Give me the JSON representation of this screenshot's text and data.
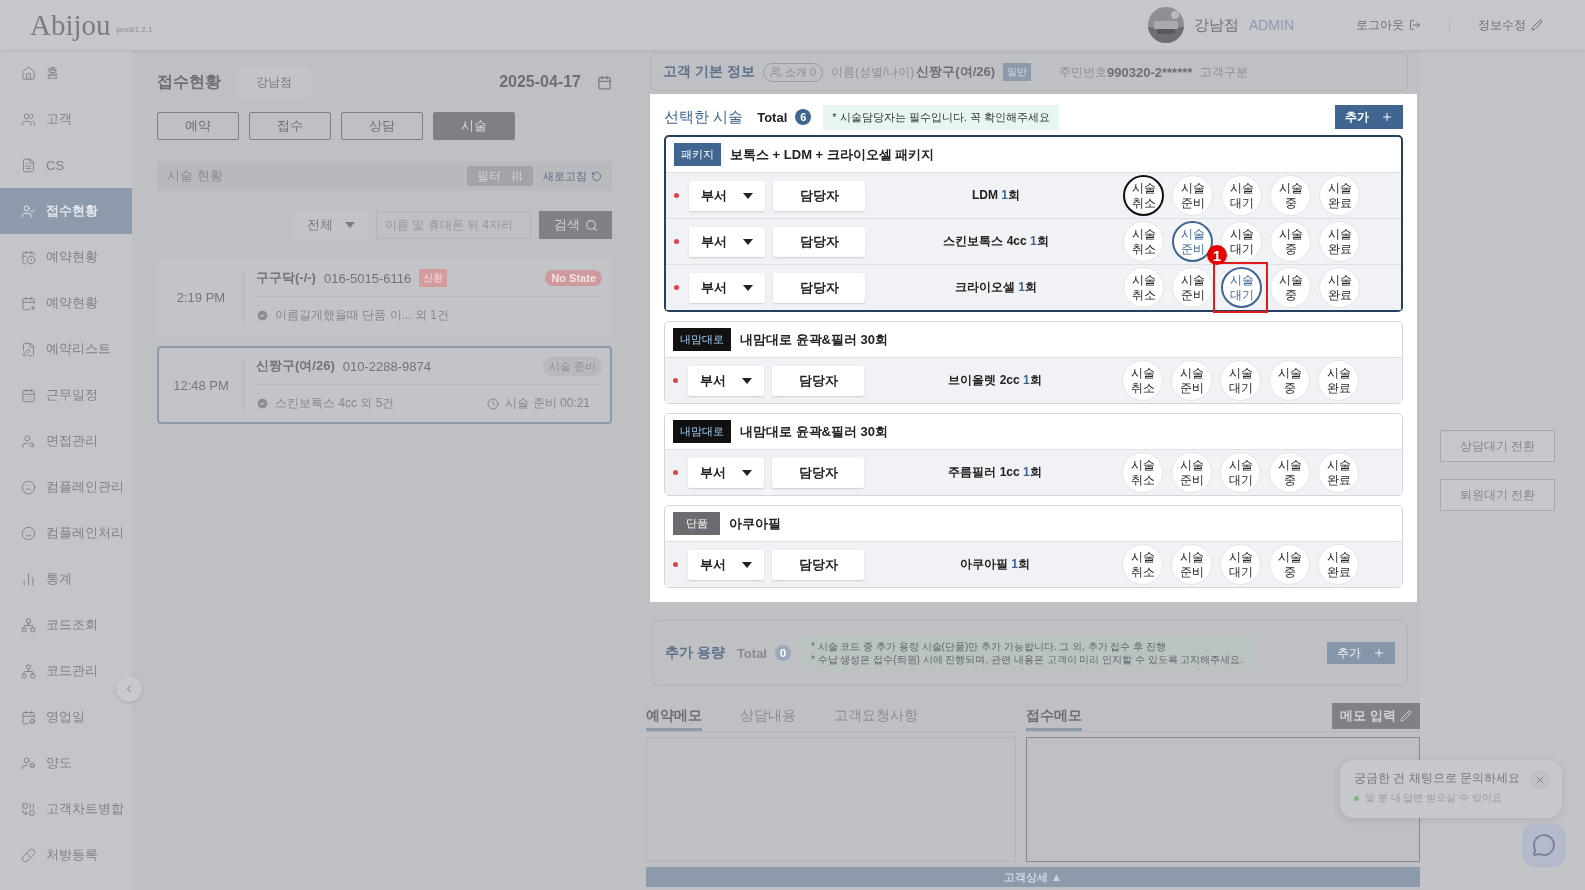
{
  "header": {
    "logo": "Abijou",
    "version": "prod/1.2.1",
    "branch": "강남점",
    "role": "ADMIN",
    "logout": "로그아웃",
    "edit_info": "정보수정"
  },
  "sidebar": {
    "items": [
      {
        "label": "홈",
        "selected": false
      },
      {
        "label": "고객",
        "selected": false
      },
      {
        "label": "CS",
        "selected": false
      },
      {
        "label": "접수현황",
        "selected": true
      },
      {
        "label": "예약현황",
        "selected": false
      },
      {
        "label": "예약현황",
        "selected": false
      },
      {
        "label": "예약리스트",
        "selected": false
      },
      {
        "label": "근무일정",
        "selected": false
      },
      {
        "label": "면접관리",
        "selected": false
      },
      {
        "label": "컴플레인관리",
        "selected": false
      },
      {
        "label": "컴플레인처리",
        "selected": false
      },
      {
        "label": "통계",
        "selected": false
      },
      {
        "label": "코드조회",
        "selected": false
      },
      {
        "label": "코드관리",
        "selected": false
      },
      {
        "label": "영업일",
        "selected": false
      },
      {
        "label": "양도",
        "selected": false
      },
      {
        "label": "고객차트병합",
        "selected": false
      },
      {
        "label": "처방등록",
        "selected": false
      }
    ]
  },
  "reception": {
    "title": "접수현황",
    "branch": "강남점",
    "date": "2025-04-17",
    "tabs": [
      {
        "label": "예약",
        "selected": false
      },
      {
        "label": "접수",
        "selected": false
      },
      {
        "label": "상담",
        "selected": false
      },
      {
        "label": "시술",
        "selected": true
      }
    ],
    "section": {
      "title": "시술 현황",
      "filter": "필터",
      "refresh": "새로고침"
    },
    "filter_select": "전체",
    "search": {
      "placeholder": "이름 및 휴대폰 뒤 4자리",
      "button": "검색"
    },
    "cards": [
      {
        "time": "2:19 PM",
        "name": "구구닥(-/-)",
        "phone": "016-5015-6116",
        "tag": "신환",
        "status": {
          "text": "No State",
          "kind": "alert"
        },
        "detail": "이름길게했을때 단품 이... 외 1건",
        "selected": false
      },
      {
        "time": "12:48 PM",
        "name": "신짱구(여/26)",
        "phone": "010-2288-9874",
        "status": {
          "text": "시술 준비",
          "kind": "normal"
        },
        "detail": "스킨보톡스 4cc 외 5건",
        "timer": "시술 준비 00:21",
        "selected": true
      }
    ]
  },
  "customer": {
    "title": "고객 기본 정보",
    "referral": "소개 0",
    "name_label": "이름(성별/나이)",
    "name": "신짱구(여/26)",
    "grade": "일반",
    "id_label": "주민번호",
    "id_number": "990320-2******",
    "type_label": "고객구분"
  },
  "selected_procedures": {
    "title": "선택한 시술",
    "total_label": "Total",
    "total": "6",
    "notice": "* 시술담당자는 필수입니다. 꼭 확인해주세요",
    "add": "추가",
    "groups": [
      {
        "kind": "package",
        "tag": "패키지",
        "name": "보톡스 + LDM + 크라이오셀 패키지",
        "selected": true,
        "rows": [
          {
            "dept": "부서",
            "staff": "담당자",
            "name": "LDM",
            "count": "1",
            "unit": "회",
            "statuses": [
              {
                "label": "시술 취소",
                "selected": true
              },
              {
                "label": "시술 준비",
                "selected": false
              },
              {
                "label": "시술 대기",
                "selected": false
              },
              {
                "label": "시술 중",
                "selected": false
              },
              {
                "label": "시술 완료",
                "selected": false
              }
            ]
          },
          {
            "dept": "부서",
            "staff": "담당자",
            "name": "스킨보톡스 4cc",
            "count": "1",
            "unit": "회",
            "statuses": [
              {
                "label": "시술 취소",
                "selected": false
              },
              {
                "label": "시술 준비",
                "selected": true
              },
              {
                "label": "시술 대기",
                "selected": false
              },
              {
                "label": "시술 중",
                "selected": false
              },
              {
                "label": "시술 완료",
                "selected": false
              }
            ]
          },
          {
            "dept": "부서",
            "staff": "담당자",
            "name": "크라이오셀",
            "count": "1",
            "unit": "회",
            "statuses": [
              {
                "label": "시술 취소",
                "selected": false
              },
              {
                "label": "시술 준비",
                "selected": false
              },
              {
                "label": "시술 대기",
                "selected": true,
                "callout": "1"
              },
              {
                "label": "시술 중",
                "selected": false
              },
              {
                "label": "시술 완료",
                "selected": false
              }
            ]
          }
        ]
      },
      {
        "kind": "custom",
        "tag": "내맘대로",
        "name": "내맘대로 윤곽&필러 30회",
        "selected": false,
        "rows": [
          {
            "dept": "부서",
            "staff": "담당자",
            "name": "브이올렛 2cc",
            "count": "1",
            "unit": "회",
            "statuses": [
              {
                "label": "시술 취소",
                "selected": false
              },
              {
                "label": "시술 준비",
                "selected": false
              },
              {
                "label": "시술 대기",
                "selected": false
              },
              {
                "label": "시술 중",
                "selected": false
              },
              {
                "label": "시술 완료",
                "selected": false
              }
            ]
          }
        ]
      },
      {
        "kind": "custom",
        "tag": "내맘대로",
        "name": "내맘대로 윤곽&필러 30회",
        "selected": false,
        "rows": [
          {
            "dept": "부서",
            "staff": "담당자",
            "name": "주름필러 1cc",
            "count": "1",
            "unit": "회",
            "statuses": [
              {
                "label": "시술 취소",
                "selected": false
              },
              {
                "label": "시술 준비",
                "selected": false
              },
              {
                "label": "시술 대기",
                "selected": false
              },
              {
                "label": "시술 중",
                "selected": false
              },
              {
                "label": "시술 완료",
                "selected": false
              }
            ]
          }
        ]
      },
      {
        "kind": "single",
        "tag": "단품",
        "name": "아쿠아필",
        "selected": false,
        "rows": [
          {
            "dept": "부서",
            "staff": "담당자",
            "name": "아쿠아필",
            "count": "1",
            "unit": "회",
            "statuses": [
              {
                "label": "시술 취소",
                "selected": false
              },
              {
                "label": "시술 준비",
                "selected": false
              },
              {
                "label": "시술 대기",
                "selected": false
              },
              {
                "label": "시술 중",
                "selected": false
              },
              {
                "label": "시술 완료",
                "selected": false
              }
            ]
          }
        ]
      }
    ]
  },
  "extra_volume": {
    "title": "추가 용량",
    "total_label": "Total",
    "total": "0",
    "notes": [
      "* 시술 코드 중 추가 용량 시술(단품)만 추가 가능합니다. 그 외, 추가 접수 후 진행",
      "* 수납 생성은 접수(퇴원) 시에 진행되며, 관련 내용은 고객이 미리 인지할 수 있도록 고지해주세요."
    ],
    "add": "추가"
  },
  "memo": {
    "left_tabs": [
      {
        "label": "예약메모",
        "selected": true
      },
      {
        "label": "상담내용",
        "selected": false
      },
      {
        "label": "고객요청사항",
        "selected": false
      }
    ],
    "right_tabs": [
      {
        "label": "접수메모",
        "selected": true
      }
    ],
    "memo_button": "메모 입력",
    "footer": "고객상세 ▲"
  },
  "side_actions": [
    "상담대기 전환",
    "퇴원대기 전환"
  ],
  "chat": {
    "title": "궁금한 건 채팅으로 문의하세요",
    "subtitle": "몇 분 내 답변 받으실 수 있어요",
    "online": true
  }
}
